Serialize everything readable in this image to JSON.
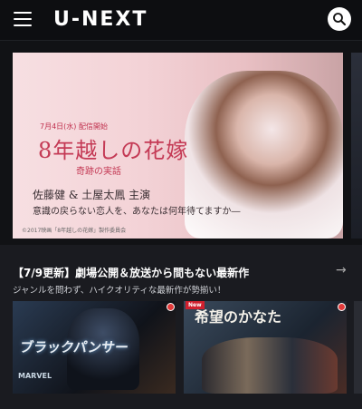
{
  "app": {
    "logo": "U-NEXT"
  },
  "hero": {
    "date": "7月4日(水) 配信開始",
    "title": "8年越しの花嫁",
    "subtitle": "奇跡の実話",
    "cast": "佐藤健 & 土屋太鳳 主演",
    "tagline": "意識の戻らない恋人を、あなたは何年待てますか―",
    "copyright": "©2017映画「8年越しの花嫁」製作委員会"
  },
  "section": {
    "title": "【7/9更新】劇場公開＆放送から間もない最新作",
    "subtitle": "ジャンルを問わず、ハイクオリティな最新作が勢揃い！",
    "arrow": "→"
  },
  "cards": [
    {
      "title": "ブラックパンサー",
      "logo": "MARVEL"
    },
    {
      "title": "希望のかなた",
      "badge": "New"
    }
  ],
  "icons": {
    "menu": "menu-icon",
    "search": "search-icon",
    "arrow": "arrow-right-icon"
  }
}
